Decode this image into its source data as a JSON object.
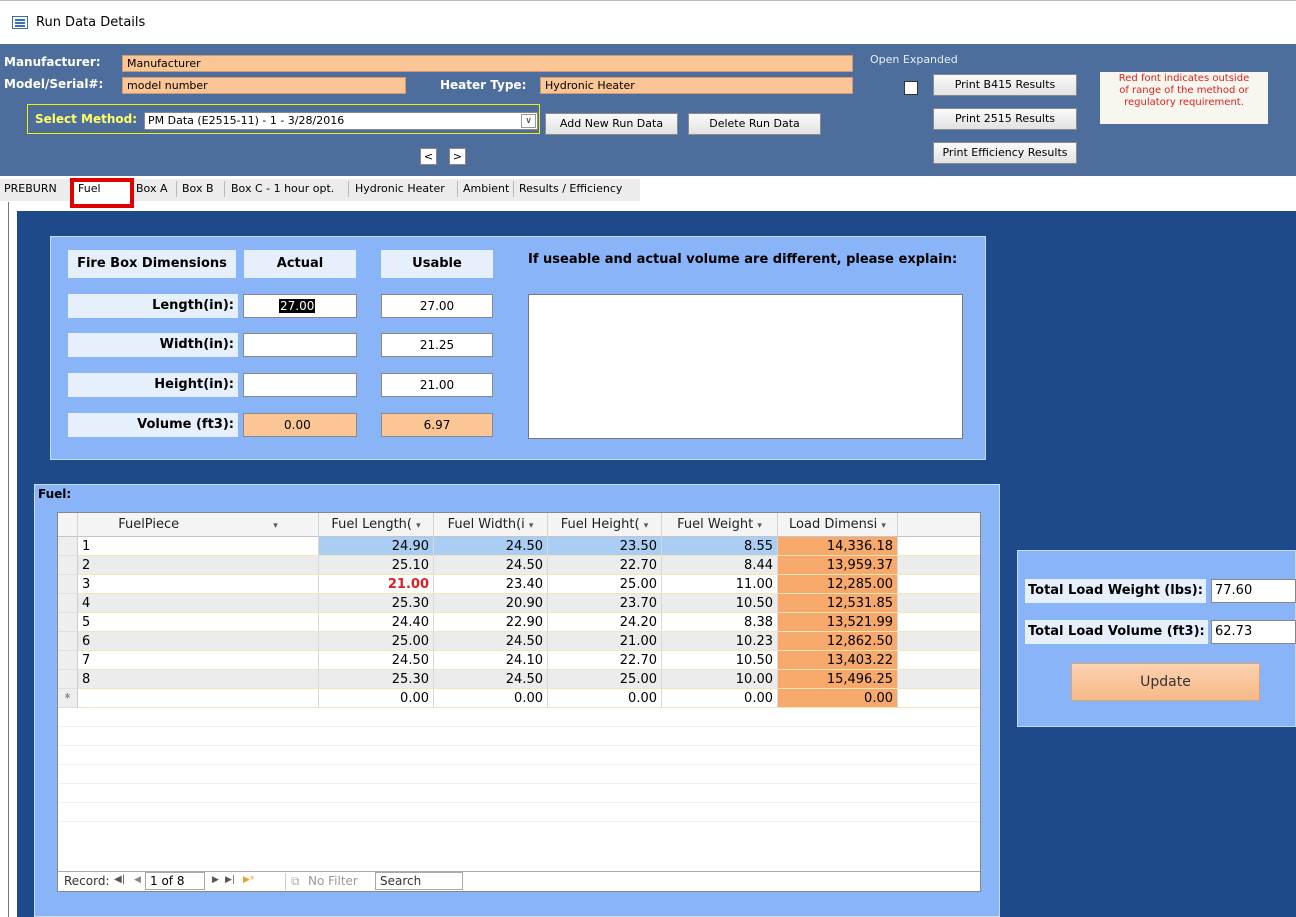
{
  "window": {
    "title": "Run Data Details"
  },
  "header": {
    "manufacturer_label": "Manufacturer:",
    "manufacturer_value": "Manufacturer",
    "model_label": "Model/Serial#:",
    "model_value": "model number",
    "heater_type_label": "Heater Type:",
    "heater_type_value": "Hydronic Heater",
    "select_method_label": "Select Method:",
    "select_method_value": "PM Data (E2515-11) - 1 - 3/28/2016",
    "add_button": "Add New Run Data",
    "delete_button": "Delete Run Data",
    "prev_button": "<",
    "next_button": ">",
    "open_expanded_label": "Open Expanded",
    "open_expanded_checked": false,
    "print_b415": "Print B415 Results",
    "print_2515": "Print 2515 Results",
    "print_efficiency": "Print Efficiency Results",
    "red_note_line1": "Red font indicates outside",
    "red_note_line2": "of range of the method or",
    "red_note_line3": "regulatory requirement."
  },
  "tabs": [
    "PREBURN",
    "Fuel",
    "Box A",
    "Box B",
    "Box C - 1 hour opt.",
    "Hydronic Heater",
    "Ambient",
    "Results / Efficiency"
  ],
  "active_tab": "Fuel",
  "firebox": {
    "header_dimensions": "Fire Box Dimensions",
    "header_actual": "Actual",
    "header_usable": "Usable",
    "explain_label": "If useable and actual volume are different, please explain:",
    "explain_value": "",
    "rows": [
      {
        "label": "Length(in):",
        "actual": "27.00",
        "usable": "27.00"
      },
      {
        "label": "Width(in):",
        "actual": "",
        "usable": "21.25"
      },
      {
        "label": "Height(in):",
        "actual": "",
        "usable": "21.00"
      },
      {
        "label": "Volume (ft3):",
        "actual": "0.00",
        "usable": "6.97"
      }
    ]
  },
  "fuel": {
    "section_label": "Fuel:",
    "columns": [
      "FuelPiece",
      "Fuel Length(",
      "Fuel Width(i",
      "Fuel Height(",
      "Fuel Weight",
      "Load Dimensi"
    ],
    "rows": [
      [
        "1",
        "24.90",
        "24.50",
        "23.50",
        "8.55",
        "14,336.18"
      ],
      [
        "2",
        "25.10",
        "24.50",
        "22.70",
        "8.44",
        "13,959.37"
      ],
      [
        "3",
        "21.00",
        "23.40",
        "25.00",
        "11.00",
        "12,285.00"
      ],
      [
        "4",
        "25.30",
        "20.90",
        "23.70",
        "10.50",
        "12,531.85"
      ],
      [
        "5",
        "24.40",
        "22.90",
        "24.20",
        "8.38",
        "13,521.99"
      ],
      [
        "6",
        "25.00",
        "24.50",
        "21.00",
        "10.23",
        "12,862.50"
      ],
      [
        "7",
        "24.50",
        "24.10",
        "22.70",
        "10.50",
        "13,403.22"
      ],
      [
        "8",
        "25.30",
        "24.50",
        "25.00",
        "10.00",
        "15,496.25"
      ]
    ],
    "new_row": [
      "",
      "0.00",
      "0.00",
      "0.00",
      "0.00",
      "0.00"
    ],
    "new_row_marker": "*",
    "out_of_range_color": "#e02020",
    "record_nav": {
      "label": "Record:",
      "position": "1 of 8",
      "filter": "No Filter",
      "search": "Search"
    }
  },
  "totals": {
    "weight_label": "Total Load Weight (lbs):",
    "weight_value": "77.60",
    "volume_label": "Total Load Volume (ft3):",
    "volume_value": "62.73",
    "update_button": "Update"
  }
}
